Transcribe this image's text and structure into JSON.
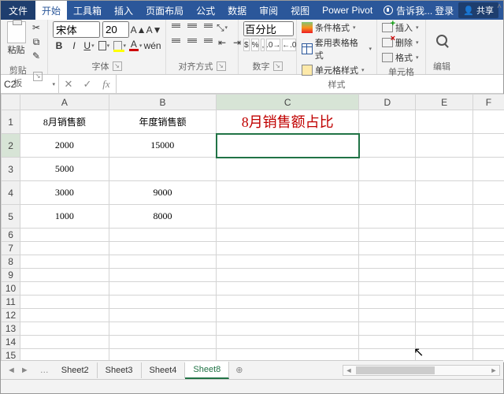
{
  "tabs": {
    "file": "文件",
    "home": "开始",
    "toolbox": "工具箱",
    "insert": "插入",
    "layout": "页面布局",
    "formulas": "公式",
    "data": "数据",
    "review": "审阅",
    "view": "视图",
    "powerpivot": "Power Pivot"
  },
  "tell": "告诉我...",
  "login": "登录",
  "share": "共享",
  "ribbon": {
    "paste": "粘贴",
    "clipboard": "剪贴板",
    "font_name": "宋体",
    "font_size": "20",
    "font_group": "字体",
    "align_group": "对齐方式",
    "number_format": "百分比",
    "number_group": "数字",
    "cond_fmt": "条件格式",
    "tbl_fmt": "套用表格格式",
    "cell_style": "单元格样式",
    "styles_group": "样式",
    "insert": "插入",
    "delete": "删除",
    "format": "格式",
    "cells_group": "单元格",
    "editing": "编辑"
  },
  "namebox": "C2",
  "cols": [
    "A",
    "B",
    "C",
    "D",
    "E",
    "F"
  ],
  "rows": [
    "1",
    "2",
    "3",
    "4",
    "5",
    "6",
    "7",
    "8",
    "9",
    "10",
    "11",
    "12",
    "13",
    "14",
    "15"
  ],
  "cells": {
    "A1": "8月销售额",
    "B1": "年度销售额",
    "C1": "8月销售额占比",
    "A2": "2000",
    "B2": "15000",
    "A3": "5000",
    "A4": "3000",
    "B4": "9000",
    "A5": "1000",
    "B5": "8000"
  },
  "sheets": {
    "s2": "Sheet2",
    "s3": "Sheet3",
    "s4": "Sheet4",
    "s8": "Sheet8"
  }
}
